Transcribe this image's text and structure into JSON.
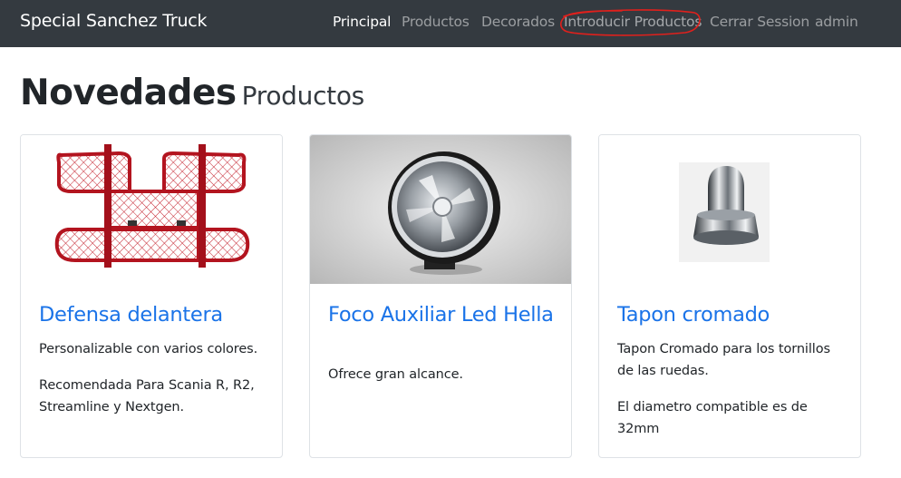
{
  "navbar": {
    "brand": "Special Sanchez Truck",
    "links": [
      {
        "label": "Principal",
        "active": true
      },
      {
        "label": "Productos",
        "active": false
      },
      {
        "label": "Decorados",
        "active": false
      },
      {
        "label": "Introducir Productos",
        "active": false,
        "highlighted": true
      },
      {
        "label": "Cerrar Session",
        "active": false
      },
      {
        "label": "admin",
        "active": false
      }
    ]
  },
  "heading": {
    "main": "Novedades",
    "sub": "Productos"
  },
  "products": [
    {
      "title": "Defensa delantera",
      "paragraphs": [
        "Personalizable con varios colores.",
        "Recomendada Para Scania R, R2, Streamline y Nextgen."
      ],
      "image": "red-front-bumper-guard"
    },
    {
      "title": "Foco Auxiliar Led Hella",
      "paragraphs": [
        "Ofrece gran alcance."
      ],
      "image": "round-led-spotlight"
    },
    {
      "title": "Tapon cromado",
      "paragraphs": [
        "Tapon Cromado para los tornillos de las ruedas.",
        "El diametro compatible es de 32mm"
      ],
      "image": "chrome-lug-nut-cap"
    }
  ],
  "colors": {
    "navbar_bg": "#343a40",
    "link_blue": "#1a73e8",
    "annotation_red": "#e0201c"
  }
}
